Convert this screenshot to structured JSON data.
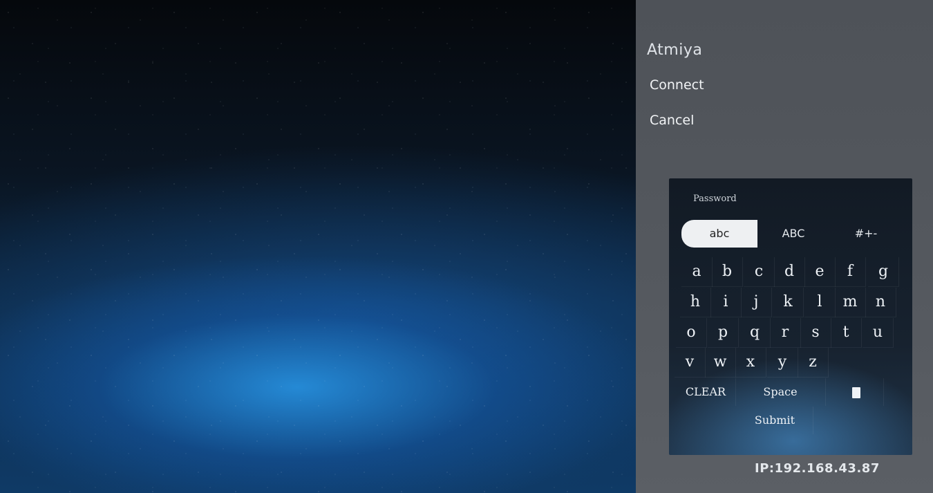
{
  "panel": {
    "title": "Atmiya",
    "menu": [
      {
        "label": "Connect"
      },
      {
        "label": "Cancel"
      }
    ]
  },
  "keyboard": {
    "field_label": "Password",
    "modes": [
      {
        "label": "abc",
        "selected": true
      },
      {
        "label": "ABC",
        "selected": false
      },
      {
        "label": "#+-",
        "selected": false
      }
    ],
    "rows": [
      [
        "a",
        "b",
        "c",
        "d",
        "e",
        "f",
        "g"
      ],
      [
        "h",
        "i",
        "j",
        "k",
        "l",
        "m",
        "n"
      ],
      [
        "o",
        "p",
        "q",
        "r",
        "s",
        "t",
        "u"
      ],
      [
        "v",
        "w",
        "x",
        "y",
        "z"
      ]
    ],
    "clear_label": "CLEAR",
    "space_label": "Space",
    "backspace_icon": "backspace-icon",
    "submit_label": "Submit"
  },
  "status": {
    "ip": "IP:192.168.43.87"
  },
  "colors": {
    "panel": "#55595f",
    "selected_tab": "#eef0f2",
    "sky_glow": "#2896e6"
  }
}
